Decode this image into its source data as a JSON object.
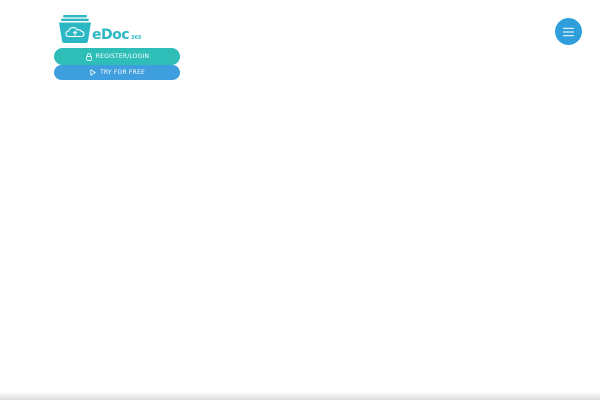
{
  "brand": {
    "logo_text": "eDoc",
    "logo_suffix": "365",
    "logo_icon": "cloud-box-icon",
    "color": "#2bb7c4"
  },
  "buttons": {
    "register_label": "REGISTER/LOGIN",
    "register_icon": "lock-icon",
    "register_color": "#2fbdb8",
    "try_label": "TRY FOR FREE",
    "try_icon": "play-icon",
    "try_color": "#3e9ede"
  },
  "menu": {
    "icon": "hamburger-menu-icon",
    "color": "#2e9fdc"
  }
}
